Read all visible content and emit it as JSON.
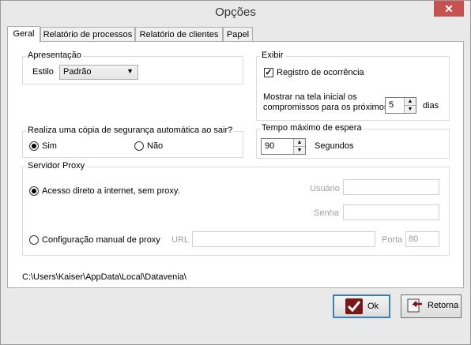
{
  "window": {
    "title": "Opções",
    "close_symbol": "✕"
  },
  "tabs": [
    {
      "label": "Geral",
      "active": true
    },
    {
      "label": "Relatório de processos",
      "active": false
    },
    {
      "label": "Relatório de clientes",
      "active": false
    },
    {
      "label": "Papel",
      "active": false
    }
  ],
  "apresentacao": {
    "legend": "Apresentação",
    "estilo_label": "Estilo",
    "estilo_value": "Padrão"
  },
  "exibir": {
    "legend": "Exibir",
    "registro_label": "Registro de ocorrência",
    "registro_checked": true,
    "mostrar_line1": "Mostrar na tela inicial  os",
    "mostrar_line2": "compromissos para os próximos",
    "dias_value": "5",
    "dias_label": "dias"
  },
  "backup": {
    "legend": "Realiza uma cópia de segurança automática ao sair?",
    "sim_label": "Sim",
    "nao_label": "Não",
    "selected": "Sim"
  },
  "tempo": {
    "legend": "Tempo máximo de espera",
    "value": "90",
    "unit_label": "Segundos"
  },
  "proxy": {
    "legend": "Servidor Proxy",
    "direct_label": "Acesso direto a internet, sem proxy.",
    "manual_label": "Configuração manual de proxy",
    "selected": "direct",
    "usuario_label": "Usuário",
    "usuario_value": "",
    "senha_label": "Senha",
    "senha_value": "",
    "url_label": "URL",
    "url_value": "",
    "porta_label": "Porta",
    "porta_value": "80"
  },
  "path_text": "C:\\Users\\Kaiser\\AppData\\Local\\Datavenia\\",
  "footer": {
    "ok_label": "Ok",
    "retorna_label": "Retorna"
  }
}
